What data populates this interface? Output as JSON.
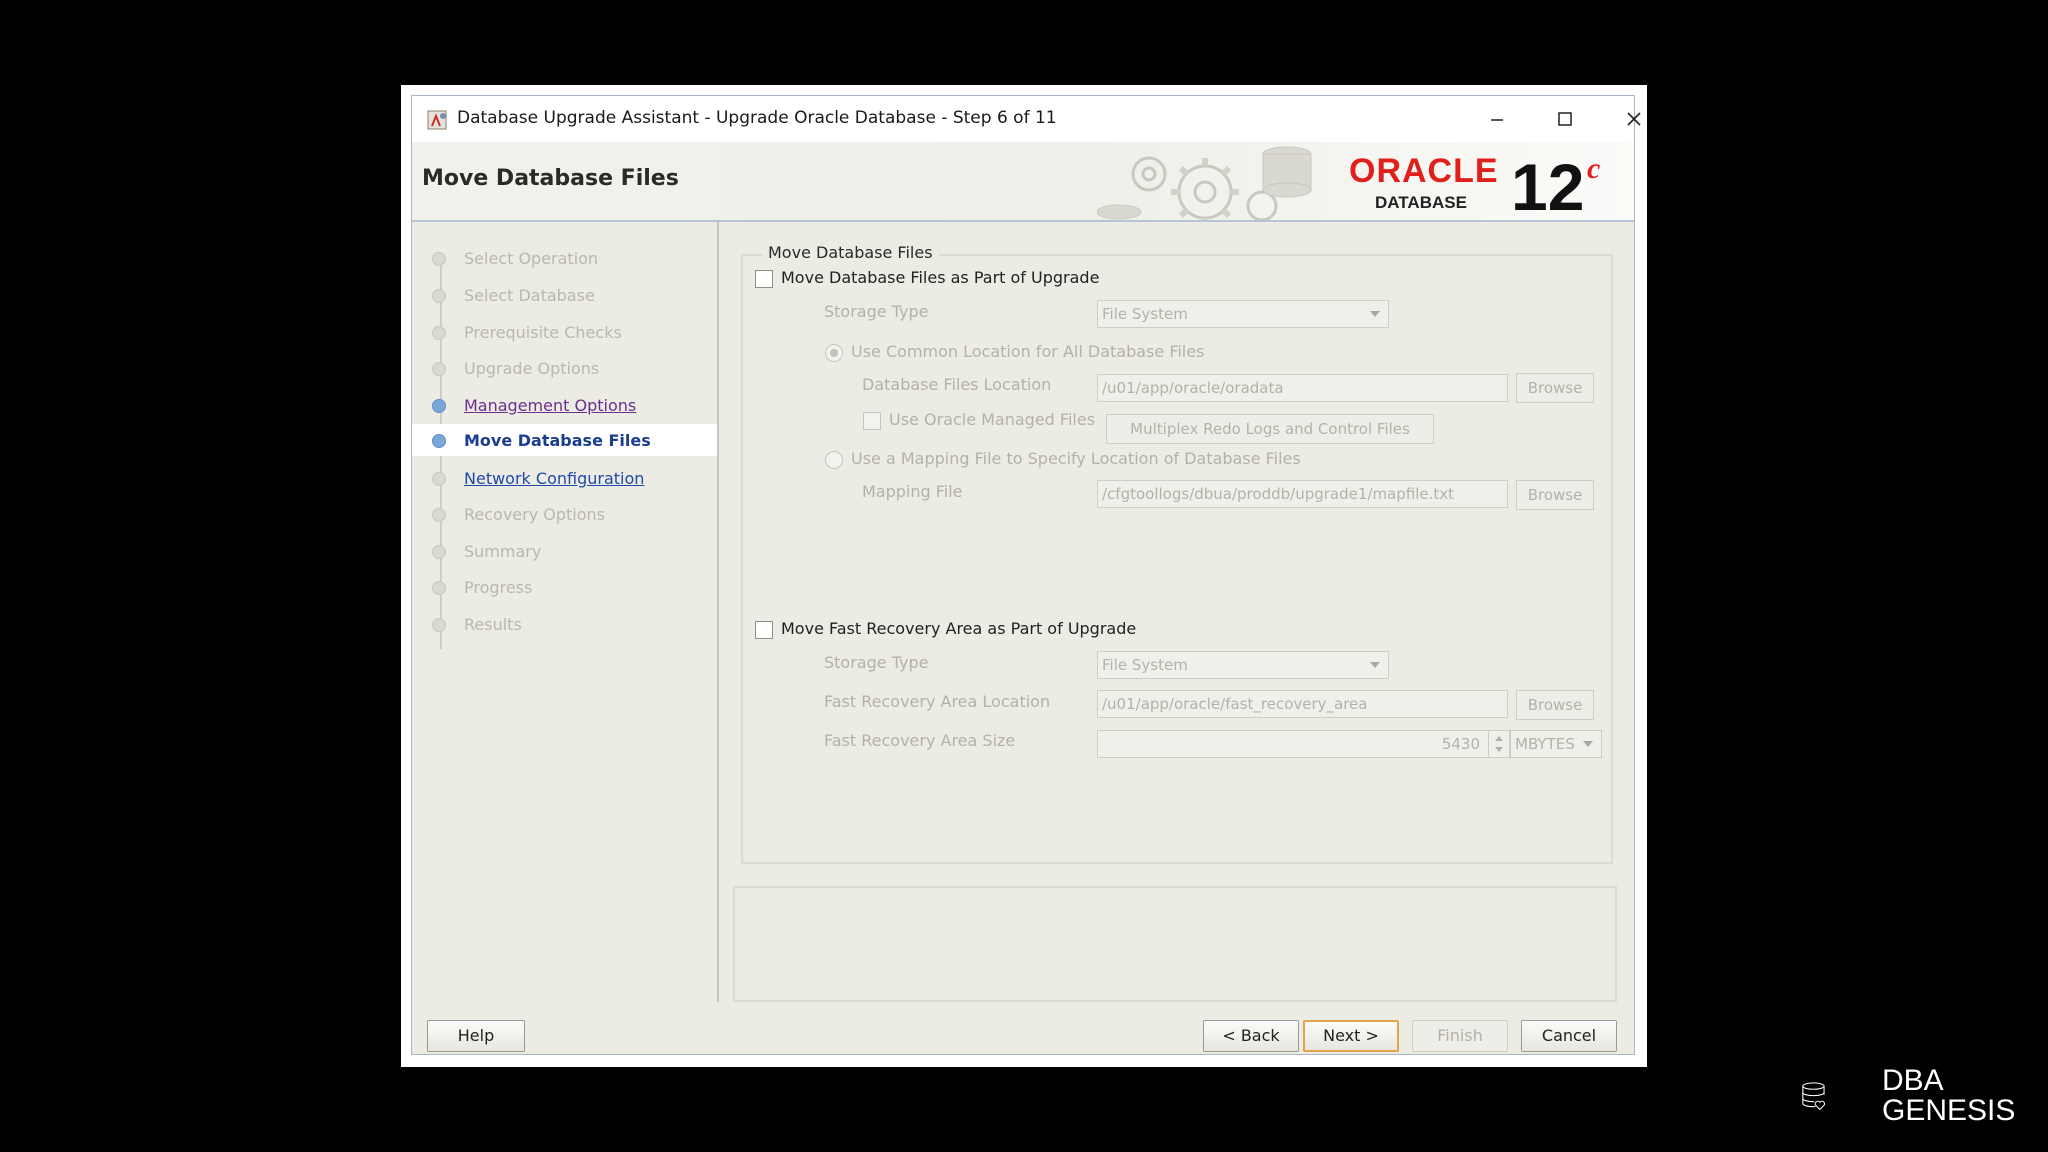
{
  "window": {
    "title": "Database Upgrade Assistant - Upgrade Oracle Database - Step 6 of 11",
    "page_title": "Move Database Files",
    "minimize_icon": "minimize-icon",
    "maximize_icon": "maximize-icon",
    "close_icon": "close-icon"
  },
  "brand": {
    "oracle": "ORACLE",
    "database": "DATABASE",
    "version": "12",
    "version_suffix": "c"
  },
  "steps": [
    {
      "label": "Select Operation",
      "state": "pending"
    },
    {
      "label": "Select Database",
      "state": "pending"
    },
    {
      "label": "Prerequisite Checks",
      "state": "pending"
    },
    {
      "label": "Upgrade Options",
      "state": "pending"
    },
    {
      "label": "Management Options",
      "state": "done"
    },
    {
      "label": "Move Database Files",
      "state": "active"
    },
    {
      "label": "Network Configuration",
      "state": "next"
    },
    {
      "label": "Recovery Options",
      "state": "pending"
    },
    {
      "label": "Summary",
      "state": "pending"
    },
    {
      "label": "Progress",
      "state": "pending"
    },
    {
      "label": "Results",
      "state": "pending"
    }
  ],
  "move_files": {
    "group_title": "Move Database Files",
    "checkbox_label": "Move Database Files as Part of Upgrade",
    "checked": false,
    "storage_type_label": "Storage Type",
    "storage_type_value": "File System",
    "common_location_label": "Use Common Location for All Database Files",
    "db_files_location_label": "Database Files Location",
    "db_files_location_value": "/u01/app/oracle/oradata",
    "browse_label": "Browse",
    "omf_label": "Use Oracle Managed Files",
    "multiplex_label": "Multiplex Redo Logs and Control Files",
    "mapping_option_label": "Use a Mapping File to Specify Location of Database Files",
    "mapping_file_label": "Mapping File",
    "mapping_file_value": "/cfgtoollogs/dbua/proddb/upgrade1/mapfile.txt"
  },
  "fra": {
    "checkbox_label": "Move Fast Recovery Area as Part of Upgrade",
    "checked": false,
    "storage_type_label": "Storage Type",
    "storage_type_value": "File System",
    "location_label": "Fast Recovery Area Location",
    "location_value": "/u01/app/oracle/fast_recovery_area",
    "browse_label": "Browse",
    "size_label": "Fast Recovery Area Size",
    "size_value": "5430",
    "size_unit": "MBYTES"
  },
  "buttons": {
    "help": "Help",
    "back": "< Back",
    "next": "Next >",
    "finish": "Finish",
    "cancel": "Cancel"
  },
  "watermark": {
    "line1": "DBA",
    "line2": "GENESIS"
  },
  "colors": {
    "oracle_red": "#e0201b",
    "active_step": "#1a3d8f",
    "link": "#1f4aa8",
    "visited": "#6b2f8f"
  }
}
